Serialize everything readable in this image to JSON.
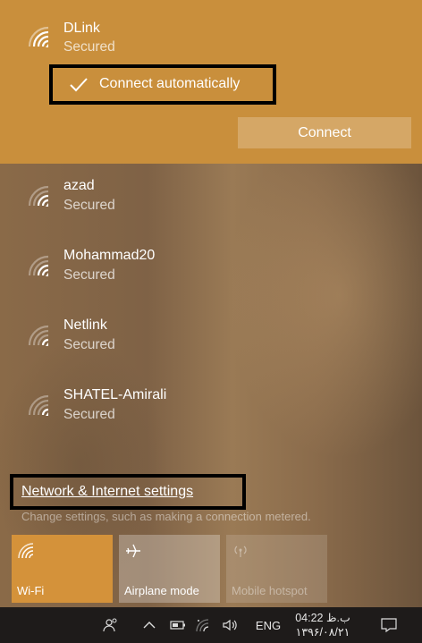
{
  "selected_network": {
    "name": "DLink",
    "status": "Secured",
    "connect_automatically_label": "Connect automatically",
    "connect_button_label": "Connect"
  },
  "networks": [
    {
      "name": "azad",
      "status": "Secured"
    },
    {
      "name": "Mohammad20",
      "status": "Secured"
    },
    {
      "name": "Netlink",
      "status": "Secured"
    },
    {
      "name": "SHATEL-Amirali",
      "status": "Secured"
    }
  ],
  "settings": {
    "link_label": "Network & Internet settings",
    "description": "Change settings, such as making a connection metered."
  },
  "quick_actions": {
    "wifi_label": "Wi-Fi",
    "airplane_label": "Airplane mode",
    "hotspot_label": "Mobile hotspot"
  },
  "taskbar": {
    "language": "ENG",
    "time": "04:22 ب.ظ",
    "date": "۱۳۹۶/۰۸/۲۱"
  },
  "colors": {
    "accent": "#c98f3c",
    "wifi_tile": "#d4923a",
    "taskbar": "#1e1b1a",
    "highlight_border": "#000000"
  },
  "icons": {
    "network": "wifi-signal-icon",
    "check": "checkmark-icon",
    "airplane": "airplane-icon",
    "hotspot": "mobile-hotspot-icon",
    "people": "people-icon",
    "chevron": "chevron-up-icon",
    "battery": "battery-icon",
    "volume": "volume-icon",
    "notifications": "action-center-icon"
  }
}
